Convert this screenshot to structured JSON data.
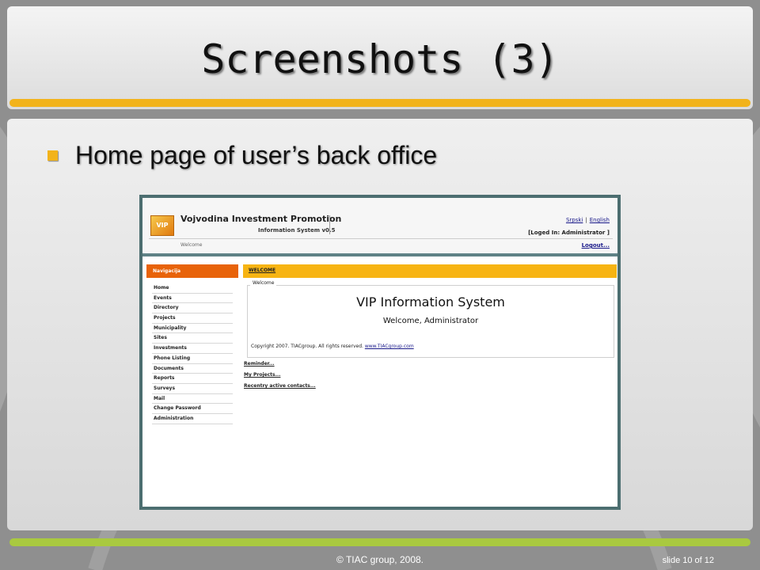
{
  "slide": {
    "title": "Screenshots (3)",
    "bullet": "Home page of user’s back office",
    "footer_copyright": "© TIAC group, 2008.",
    "footer_slide": "slide 10 of 12"
  },
  "colors": {
    "title_bar": "#f2b31b",
    "footer_bar": "#a9c940",
    "nav_header": "#e8630a",
    "tab_bar": "#f7b413",
    "screenshot_frame": "#4c6e70"
  },
  "app": {
    "logo_text": "VIP",
    "title": "Vojvodina Investment Promotion",
    "subtitle": "Information System v0.5",
    "lang_srpski": "Srpski",
    "lang_sep": "|",
    "lang_english": "English",
    "logged_in": "[Loged In: Administrator ]",
    "welcome_small": "Welcome",
    "logout": "Logout...",
    "nav_header": "Navigacija",
    "nav_items": [
      "Home",
      "Events",
      "Directory",
      "Projects",
      "Municipality",
      "Sites",
      "Investments",
      "Phone Listing",
      "Documents",
      "Reports",
      "Surveys",
      "Mail",
      "Change Password",
      "Administration"
    ],
    "tab_label": "WELCOME",
    "box_legend": "Welcome",
    "vip_title": "VIP Information System",
    "vip_welcome": "Welcome,  Administrator",
    "copyright_text": "Copyright 2007. TIACgroup. All rights reserved. ",
    "copyright_link": "www.TIACgroup.com",
    "links": [
      "Reminder...",
      "My Projects...",
      "Recentry active contacts..."
    ]
  }
}
